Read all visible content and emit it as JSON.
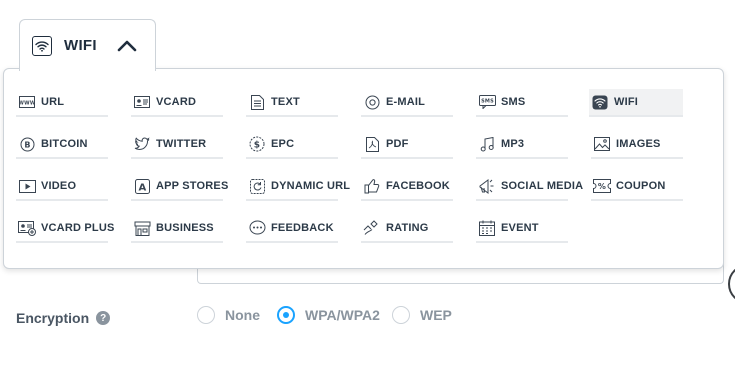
{
  "tab": {
    "label": "WIFI",
    "icon": "wifi-icon",
    "expanded": true
  },
  "menu": {
    "columns": 6,
    "items": [
      {
        "label": "URL",
        "icon": "url-icon"
      },
      {
        "label": "VCARD",
        "icon": "vcard-icon"
      },
      {
        "label": "TEXT",
        "icon": "text-icon"
      },
      {
        "label": "E-MAIL",
        "icon": "at-icon"
      },
      {
        "label": "SMS",
        "icon": "sms-icon"
      },
      {
        "label": "WIFI",
        "icon": "wifi-icon",
        "active": true
      },
      {
        "label": "BITCOIN",
        "icon": "bitcoin-icon"
      },
      {
        "label": "TWITTER",
        "icon": "twitter-icon"
      },
      {
        "label": "EPC",
        "icon": "euro-icon"
      },
      {
        "label": "PDF",
        "icon": "pdf-icon"
      },
      {
        "label": "MP3",
        "icon": "music-icon"
      },
      {
        "label": "IMAGES",
        "icon": "image-icon"
      },
      {
        "label": "VIDEO",
        "icon": "video-icon"
      },
      {
        "label": "APP STORES",
        "icon": "app-store-icon"
      },
      {
        "label": "DYNAMIC URL",
        "icon": "refresh-icon"
      },
      {
        "label": "FACEBOOK",
        "icon": "thumbs-up-icon"
      },
      {
        "label": "SOCIAL MEDIA",
        "icon": "megaphone-icon"
      },
      {
        "label": "COUPON",
        "icon": "coupon-icon"
      },
      {
        "label": "VCARD PLUS",
        "icon": "vcard-plus-icon"
      },
      {
        "label": "BUSINESS",
        "icon": "store-icon"
      },
      {
        "label": "FEEDBACK",
        "icon": "chat-icon"
      },
      {
        "label": "RATING",
        "icon": "rating-icon"
      },
      {
        "label": "EVENT",
        "icon": "calendar-icon"
      }
    ]
  },
  "encryption": {
    "label": "Encryption",
    "help": "?",
    "options": [
      {
        "label": "None",
        "selected": false
      },
      {
        "label": "WPA/WPA2",
        "selected": true
      },
      {
        "label": "WEP",
        "selected": false
      }
    ]
  },
  "colors": {
    "accent": "#1aa3ff",
    "text": "#2c3a48",
    "border": "#cdd3d9"
  }
}
